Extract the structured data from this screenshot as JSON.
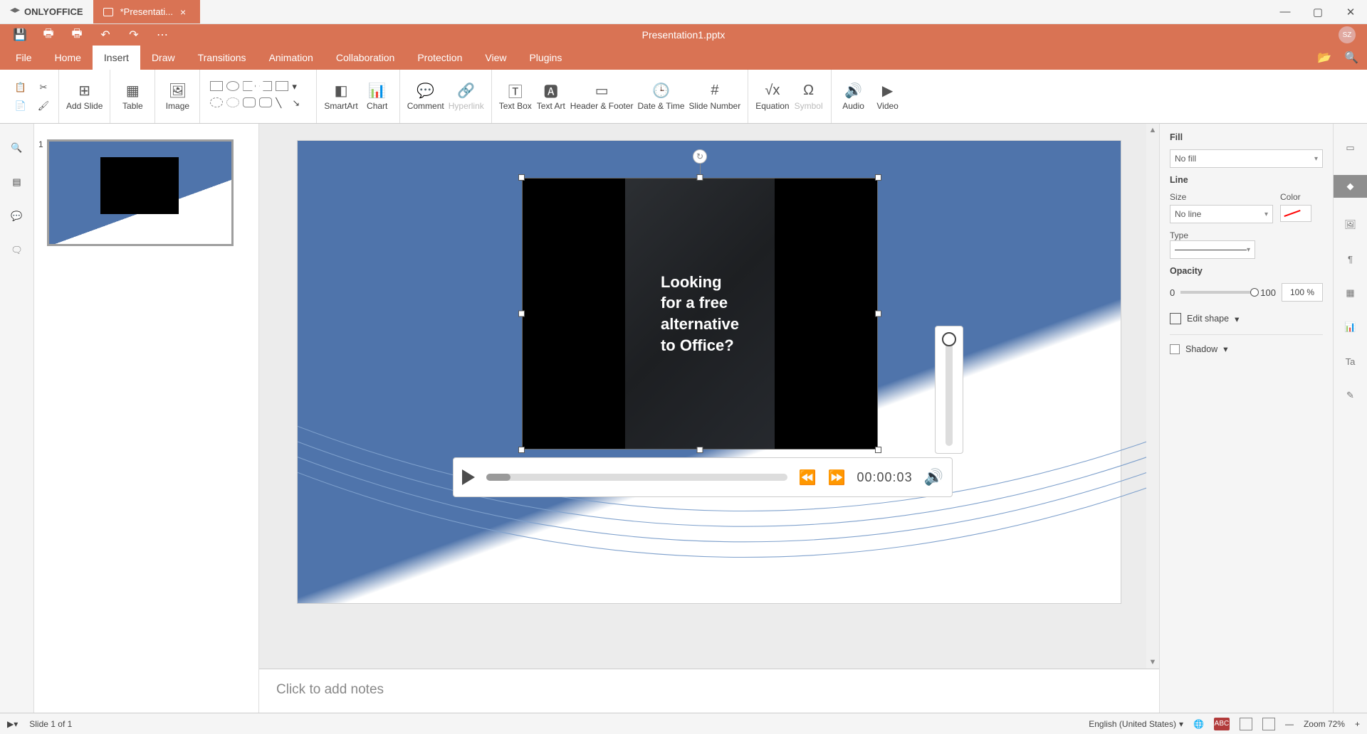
{
  "app": {
    "name": "ONLYOFFICE"
  },
  "tab": {
    "title": "*Presentati..."
  },
  "document": {
    "title": "Presentation1.pptx"
  },
  "user": {
    "initials": "SZ"
  },
  "mainTabs": [
    "File",
    "Home",
    "Insert",
    "Draw",
    "Transitions",
    "Animation",
    "Collaboration",
    "Protection",
    "View",
    "Plugins"
  ],
  "activeMainTab": "Insert",
  "ribbon": {
    "addSlide": "Add Slide",
    "table": "Table",
    "image": "Image",
    "smartArt": "SmartArt",
    "chart": "Chart",
    "comment": "Comment",
    "hyperlink": "Hyperlink",
    "textBox": "Text Box",
    "textArt": "Text Art",
    "headerFooter": "Header & Footer",
    "dateTime": "Date & Time",
    "slideNumber": "Slide Number",
    "equation": "Equation",
    "symbol": "Symbol",
    "audio": "Audio",
    "video": "Video"
  },
  "thumb": {
    "number": "1"
  },
  "videoText": {
    "l1": "Looking",
    "l2": "for a free",
    "l3": "alternative",
    "l4": "to Office?"
  },
  "player": {
    "time": "00:00:03"
  },
  "notes": {
    "placeholder": "Click to add notes"
  },
  "props": {
    "fillLabel": "Fill",
    "fillValue": "No fill",
    "lineLabel": "Line",
    "sizeLabel": "Size",
    "sizeValue": "No line",
    "colorLabel": "Color",
    "typeLabel": "Type",
    "opacityLabel": "Opacity",
    "opMin": "0",
    "opMax": "100",
    "opValue": "100 %",
    "editShape": "Edit shape",
    "shadow": "Shadow"
  },
  "status": {
    "slideInfo": "Slide 1 of 1",
    "language": "English (United States)",
    "zoom": "Zoom 72%"
  }
}
